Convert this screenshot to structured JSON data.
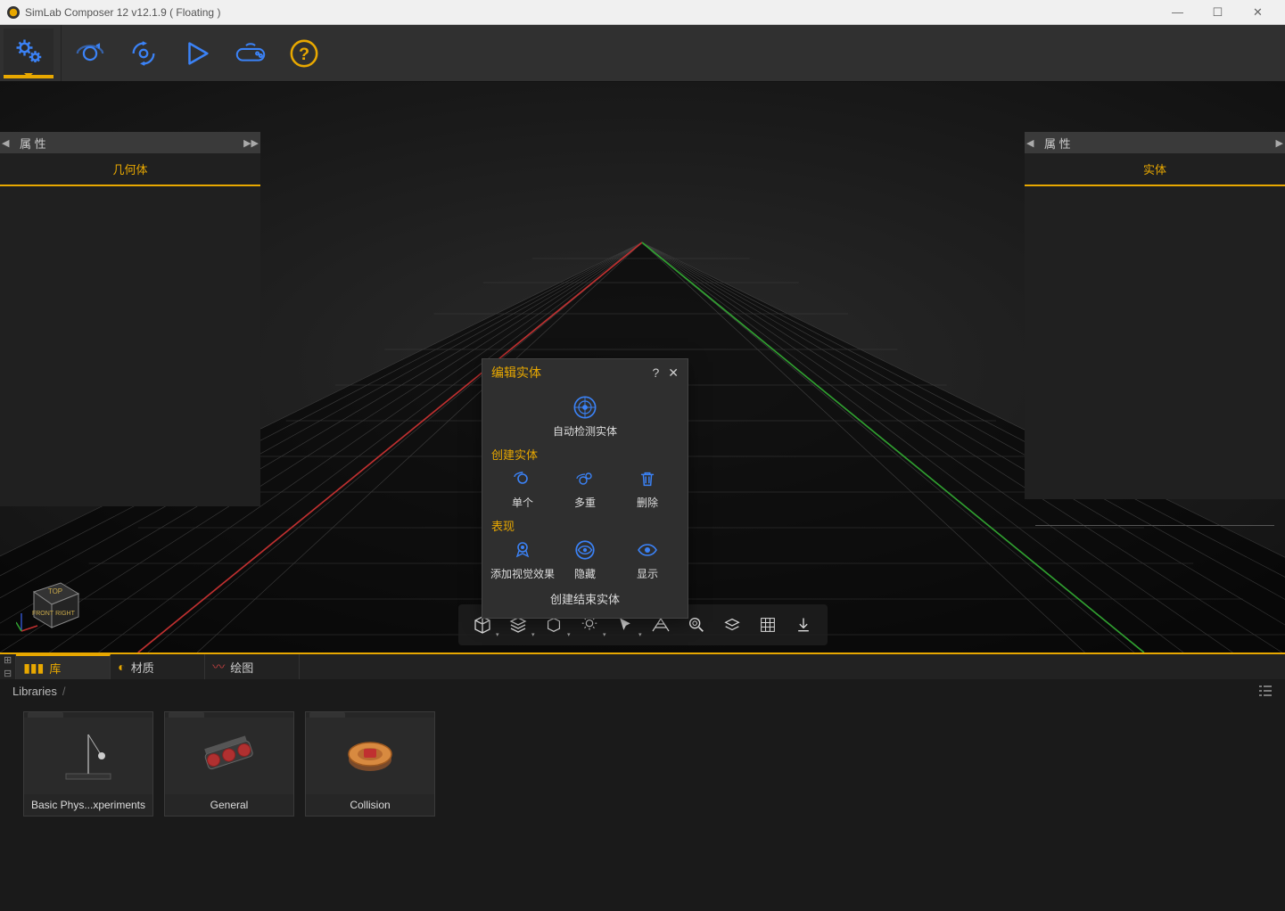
{
  "titlebar": {
    "title": "SimLab Composer 12 v12.1.9 ( Floating )"
  },
  "leftPanel": {
    "header": "属 性",
    "tab": "几何体"
  },
  "rightPanel": {
    "header": "属 性",
    "tab": "实体"
  },
  "dialog": {
    "title": "编辑实体",
    "autoDetect": "自动检测实体",
    "sectionCreate": "创建实体",
    "single": "单个",
    "multi": "多重",
    "delete": "删除",
    "sectionAppear": "表现",
    "addVisual": "添加视觉效果",
    "hide": "隐藏",
    "show": "显示",
    "createEnd": "创建结束实体"
  },
  "viewCube": {
    "top": "TOP",
    "front": "FRONT",
    "right": "RIGHT"
  },
  "bottomTabs": {
    "library": "库",
    "material": "材质",
    "drawing": "绘图"
  },
  "breadcrumb": {
    "root": "Libraries"
  },
  "cards": {
    "c1": "Basic Phys...xperiments",
    "c2": "General",
    "c3": "Collision"
  }
}
